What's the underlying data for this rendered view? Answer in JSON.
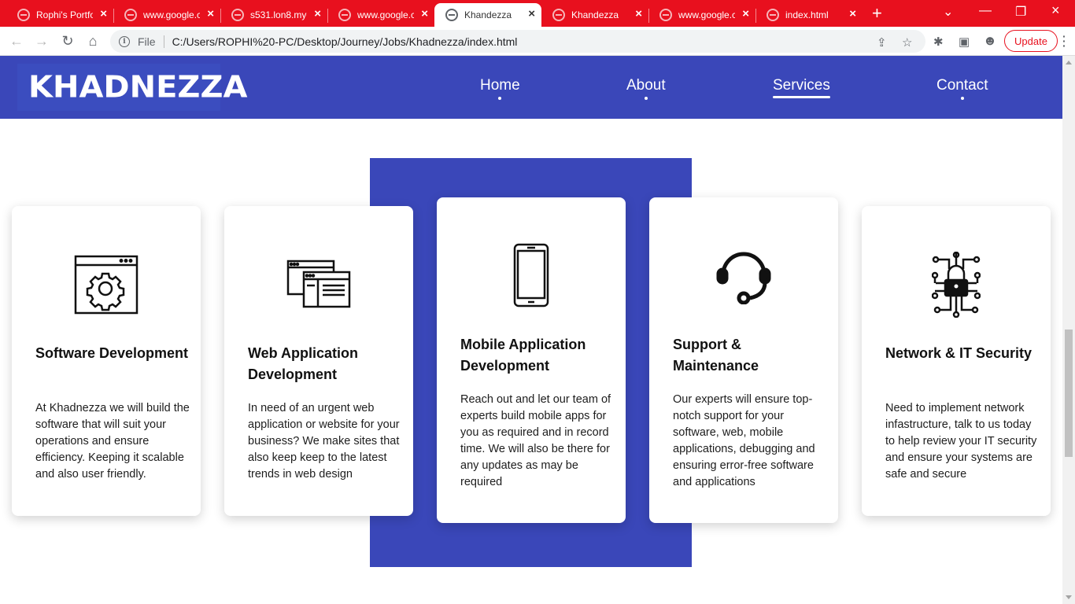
{
  "browser": {
    "tabs": [
      {
        "title": "Rophi's Portfo"
      },
      {
        "title": "www.google.c"
      },
      {
        "title": "s531.lon8.myd"
      },
      {
        "title": "www.google.c"
      },
      {
        "title": "Khandezza"
      },
      {
        "title": "Khandezza"
      },
      {
        "title": "www.google.c"
      },
      {
        "title": "index.html"
      }
    ],
    "omnibox": {
      "scheme_label": "File",
      "url": "C:/Users/ROPHI%20-PC/Desktop/Journey/Jobs/Khadnezza/index.html"
    },
    "update_label": "Update",
    "accent": "#e8101e"
  },
  "site": {
    "brand": "KHADNEZZA",
    "brand_color": "#3a47b9",
    "nav": [
      {
        "label": "Home"
      },
      {
        "label": "About"
      },
      {
        "label": "Services"
      },
      {
        "label": "Contact"
      }
    ],
    "active_nav": "Services"
  },
  "services": [
    {
      "icon": "software-settings-icon",
      "title": "Software Development",
      "text": "At Khadnezza we will build the software that will suit your operations and ensure efficiency. Keeping it scalable and also user friendly."
    },
    {
      "icon": "web-windows-icon",
      "title": "Web Application Development",
      "text": "In need of an urgent web application or website for your business? We make sites that also keep keep to the latest trends in web design"
    },
    {
      "icon": "smartphone-icon",
      "title": "Mobile Application Development",
      "text": "Reach out and let our team of experts build mobile apps for you as required and in record time. We will also be there for any updates as may be required"
    },
    {
      "icon": "headset-icon",
      "title": "Support & Maintenance",
      "text": "Our experts will ensure top-notch support for your software, web, mobile applications, debugging and ensuring error-free software and applications"
    },
    {
      "icon": "circuit-lock-icon",
      "title": "Network & IT Security",
      "text": "Need to implement network infastructure, talk to us today to help review your IT security and ensure your systems are safe and secure"
    }
  ]
}
